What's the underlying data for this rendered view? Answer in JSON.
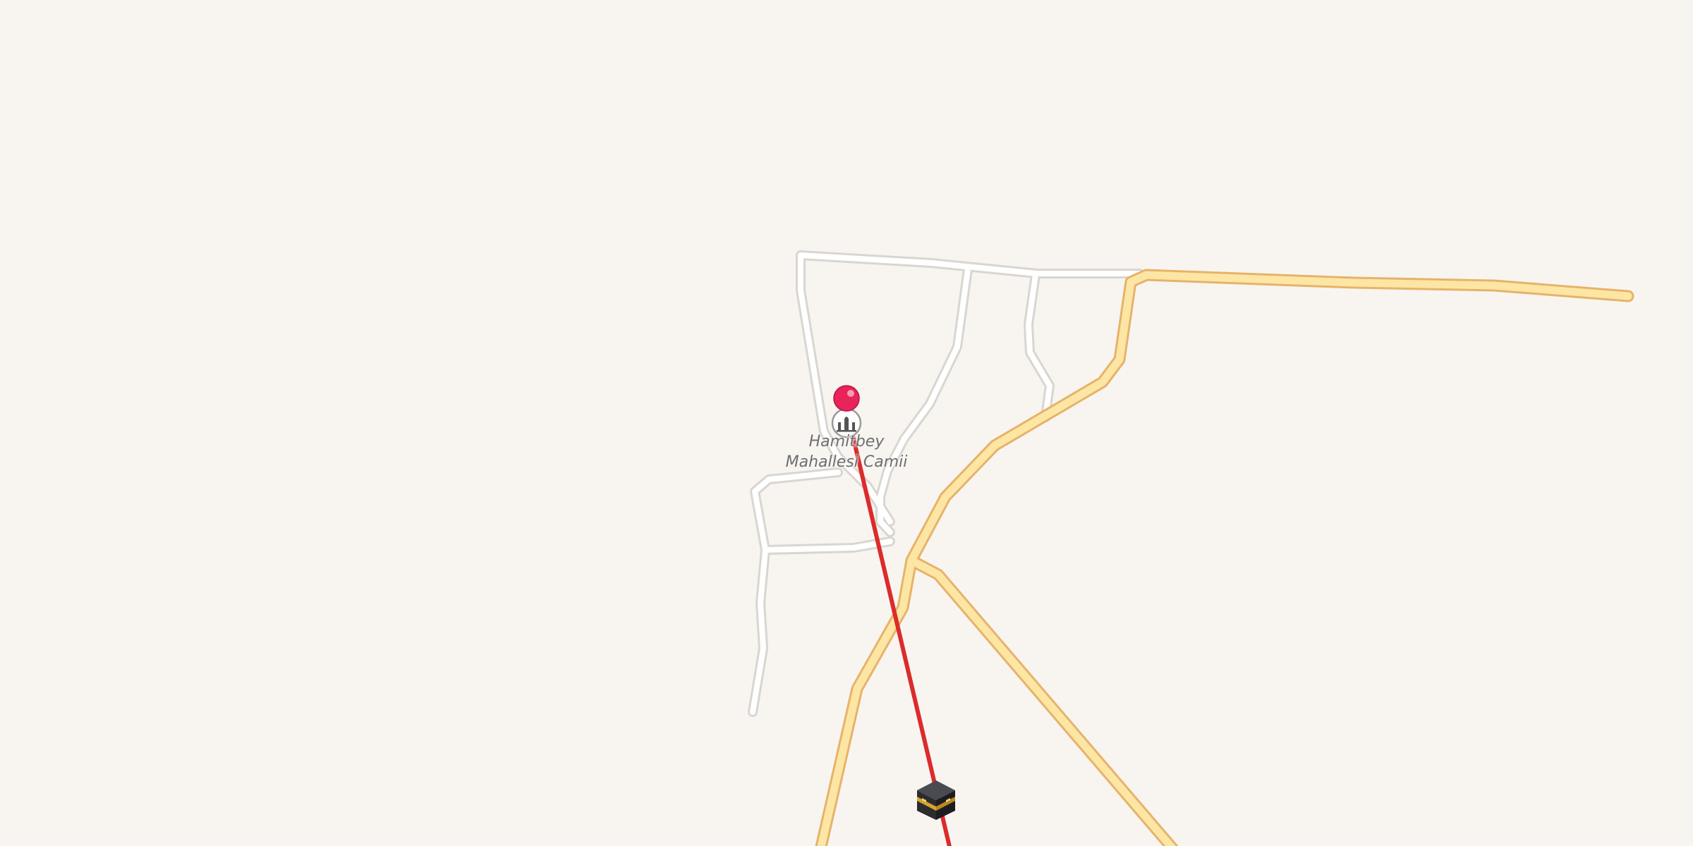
{
  "map": {
    "background_color": "#f8f5f1",
    "minor_road_color": "#ffffff",
    "minor_road_casing_color": "#d9d6d2",
    "major_road_color": "#fde6a4",
    "major_road_casing_color": "#e6b36a",
    "route_line_color": "#dc2b2b",
    "pin_color": "#e8245a"
  },
  "poi": {
    "name_line1": "Hamitbey",
    "name_line2": "Mahallesi Camii",
    "icon": "mosque-icon"
  },
  "destination": {
    "icon": "kaaba-icon"
  },
  "pin": {
    "icon": "location-pin-icon"
  }
}
